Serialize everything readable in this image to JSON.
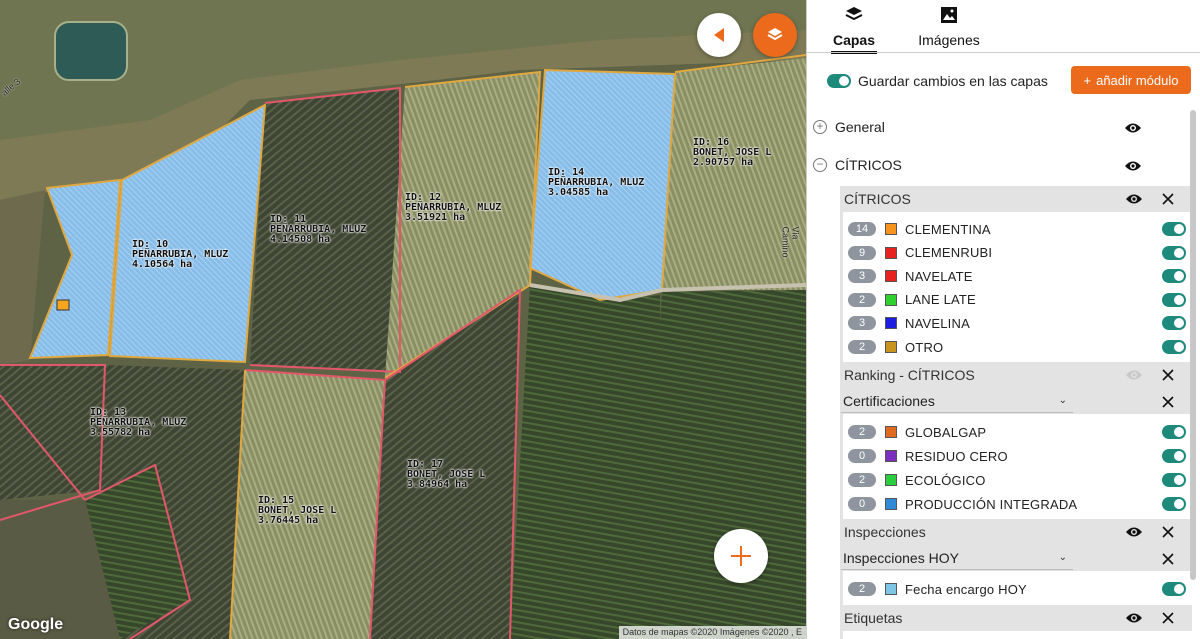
{
  "map": {
    "parcels": [
      {
        "id_line": "ID: 10",
        "owner": "PEÑARRUBIA, MLUZ",
        "area": "4.10564 ha"
      },
      {
        "id_line": "ID: 11",
        "owner": "PEÑARRUBIA, MLUZ",
        "area": "4.14508 ha"
      },
      {
        "id_line": "ID: 12",
        "owner": "PEÑARRUBIA, MLUZ",
        "area": "3.51921 ha"
      },
      {
        "id_line": "ID: 14",
        "owner": "PEÑARRUBIA, MLUZ",
        "area": "3.04585 ha"
      },
      {
        "id_line": "ID: 16",
        "owner": "BONET, JOSE L",
        "area": "2.90757 ha"
      },
      {
        "id_line": "ID: 13",
        "owner": "PEÑARRUBIA, MLUZ",
        "area": "3.55782 ha"
      },
      {
        "id_line": "ID: 15",
        "owner": "BONET, JOSE L",
        "area": "3.76445 ha"
      },
      {
        "id_line": "ID: 17",
        "owner": "BONET, JOSE L",
        "area": "3.84964 ha"
      }
    ],
    "road_labels": [
      "alle 3",
      "Via Camino"
    ],
    "google_logo": "Google",
    "attribution": "Datos de mapas ©2020 Imágenes ©2020 , E",
    "back_icon": "triangle-left-icon",
    "layers_icon": "layers-icon",
    "add_icon": "plus-icon",
    "colors": {
      "orange": "#ec6a1c",
      "selected_fill": "#7fb8e6",
      "orange_border": "#f2a53a",
      "red_border": "#e2576a"
    }
  },
  "panel": {
    "tabs": [
      {
        "label": "Capas",
        "icon": "layers-icon",
        "active": true
      },
      {
        "label": "Imágenes",
        "icon": "image-icon",
        "active": false
      }
    ],
    "save_changes": {
      "label": "Guardar cambios en las capas",
      "on": true
    },
    "add_module": {
      "icon": "+",
      "label": "añadir módulo"
    },
    "groups": [
      {
        "symbol": "+",
        "name": "General"
      },
      {
        "symbol": "−",
        "name": "CÍTRICOS"
      }
    ],
    "citricos": {
      "title": "CÍTRICOS",
      "items": [
        {
          "count": "14",
          "name": "CLEMENTINA",
          "color": "#f7941d"
        },
        {
          "count": "9",
          "name": "CLEMENRUBI",
          "color": "#e8231f"
        },
        {
          "count": "3",
          "name": "NAVELATE",
          "color": "#e8231f"
        },
        {
          "count": "2",
          "name": "LANE LATE",
          "color": "#2ed12e"
        },
        {
          "count": "3",
          "name": "NAVELINA",
          "color": "#1e1ee0"
        },
        {
          "count": "2",
          "name": "OTRO",
          "color": "#c8941e"
        }
      ]
    },
    "ranking": {
      "title": "Ranking - CÍTRICOS"
    },
    "certificaciones": {
      "dropdown": "Certificaciones",
      "items": [
        {
          "count": "2",
          "name": "GLOBALGAP",
          "color": "#e06a1e"
        },
        {
          "count": "0",
          "name": "RESIDUO CERO",
          "color": "#7a2fbf"
        },
        {
          "count": "2",
          "name": "ECOLÓGICO",
          "color": "#2ecc40"
        },
        {
          "count": "0",
          "name": "PRODUCCIÓN INTEGRADA",
          "color": "#2f8bd8"
        }
      ]
    },
    "inspecciones": {
      "title": "Inspecciones",
      "dropdown": "Inspecciones HOY",
      "items": [
        {
          "count": "2",
          "name": "Fecha encargo HOY",
          "color": "#7fc6e6"
        }
      ]
    },
    "etiquetas": {
      "title": "Etiquetas"
    }
  }
}
